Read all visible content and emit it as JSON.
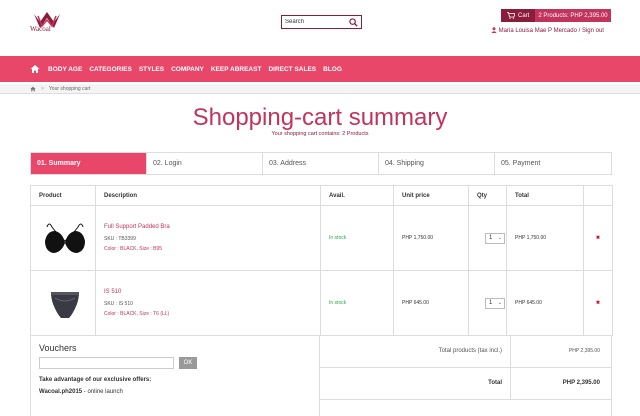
{
  "header": {
    "logo_text": "Wacoal",
    "search": {
      "placeholder": "Search",
      "value": "Search"
    },
    "cart": {
      "label": "Cart",
      "summary": "2 Products: PHP 2,395.00"
    },
    "user": {
      "name": "Maria Louisa Mae P Mercado",
      "separator": "/",
      "signout": "Sign out"
    }
  },
  "nav": {
    "items": [
      "BODY AGE",
      "CATEGORIES",
      "STYLES",
      "COMPANY",
      "KEEP ABREAST",
      "DIRECT SALES",
      "BLOG"
    ]
  },
  "breadcrumb": {
    "sep": ">",
    "current": "Your shopping cart"
  },
  "page": {
    "title": "Shopping-cart summary",
    "subtitle": "Your shopping cart contains: 2 Products"
  },
  "steps": [
    "01. Summary",
    "02. Login",
    "03. Address",
    "04. Shipping",
    "05. Payment"
  ],
  "table": {
    "headers": [
      "Product",
      "Description",
      "Avail.",
      "Unit price",
      "Qty",
      "Total"
    ],
    "rows": [
      {
        "name": "Full Support Padded Bra",
        "sku": "SKU : TB3399",
        "attrs": "Color : BLACK, Size : B95",
        "avail": "In stock",
        "unit_price": "PHP 1,750.00",
        "qty": "1",
        "total": "PHP 1,750.00"
      },
      {
        "name": "IS 510",
        "sku": "SKU : IS 510",
        "attrs": "Color : BLACK, Size : T6 (LL)",
        "avail": "In stock",
        "unit_price": "PHP 645.00",
        "qty": "1",
        "total": "PHP 645.00"
      }
    ]
  },
  "vouchers": {
    "heading": "Vouchers",
    "input_value": "",
    "ok_label": "OK",
    "offer_text": "Take advantage of our exclusive offers:",
    "code": "Wacoal.ph2015",
    "code_desc": " - online launch"
  },
  "totals": {
    "products_label": "Total products (tax incl.)",
    "products_value": "PHP 2,395.00",
    "total_label": "Total",
    "total_value": "PHP 2,395.00"
  },
  "colors": {
    "brand": "#e8476a",
    "brand_dark": "#8a1c3c",
    "accent": "#c2345b",
    "stock": "#28a745",
    "delete": "#c8102e"
  },
  "icons": [
    "wacoal-logo-icon",
    "search-icon",
    "cart-icon",
    "user-icon",
    "home-icon",
    "delete-icon",
    "select-arrow-icon"
  ]
}
